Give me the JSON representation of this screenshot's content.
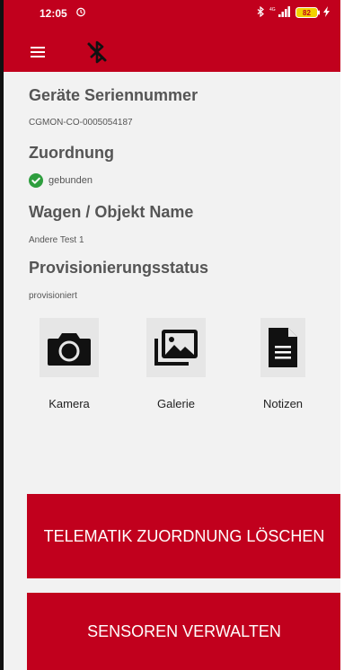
{
  "status_bar": {
    "time": "12:05",
    "battery_level": "82"
  },
  "toolbar": {
    "icons": [
      "menu-icon",
      "bluetooth-disabled-icon"
    ]
  },
  "device": {
    "serial_label": "Geräte Seriennummer",
    "serial_value": "CGMON-CO-0005054187",
    "assignment_label": "Zuordnung",
    "assignment_value": "gebunden",
    "vehicle_label": "Wagen / Objekt Name",
    "vehicle_value": "Andere Test 1",
    "provisioning_label": "Provisionierungsstatus",
    "provisioning_value": "provisioniert"
  },
  "actions": [
    {
      "label": "Kamera",
      "icon": "camera-icon"
    },
    {
      "label": "Galerie",
      "icon": "gallery-icon"
    },
    {
      "label": "Notizen",
      "icon": "notes-icon"
    }
  ],
  "buttons": {
    "delete_assignment": "TELEMATIK ZUORDNUNG LÖSCHEN",
    "manage_sensors": "SENSOREN VERWALTEN"
  },
  "colors": {
    "primary": "#c1001d",
    "success": "#2e9e3e",
    "text": "#555555",
    "tile_bg": "#e6e6e6"
  }
}
